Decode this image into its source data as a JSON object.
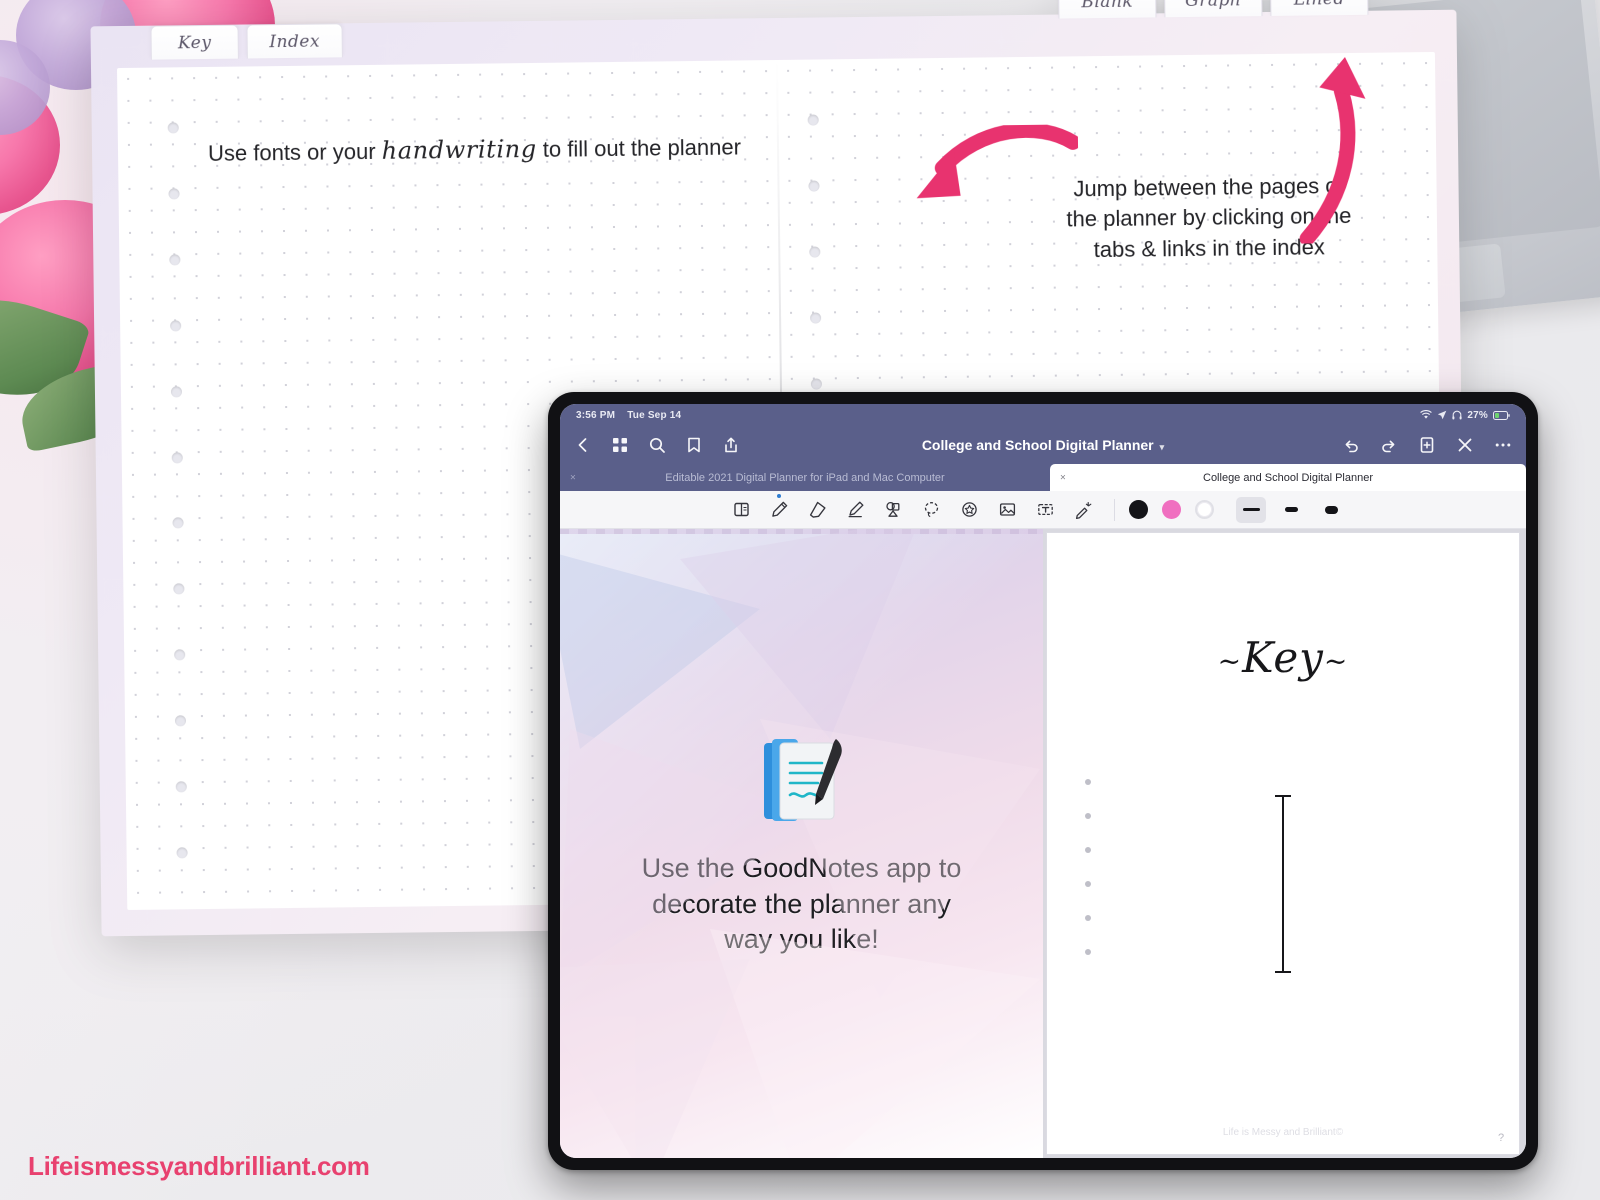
{
  "planner": {
    "tabs_left": [
      {
        "label": "Key"
      },
      {
        "label": "Index"
      }
    ],
    "tabs_top": [
      {
        "label": "Blank"
      },
      {
        "label": "Graph"
      },
      {
        "label": "Lined"
      }
    ],
    "headline": {
      "part1": "Use fonts or your ",
      "script": "handwriting",
      "part2": " to fill out the planner"
    },
    "annotation": "Jump between the pages of the planner by clicking on the tabs & links in the index"
  },
  "ipad": {
    "status_bar": {
      "time": "3:56 PM",
      "date": "Tue Sep 14",
      "battery": "27%",
      "icons": [
        "wifi-icon",
        "location-icon",
        "headphones-icon",
        "battery-icon"
      ]
    },
    "nav_bar": {
      "title": "College and School Digital Planner",
      "caret": "▾",
      "left_icons": [
        "back-chevron-icon",
        "thumbnail-grid-icon",
        "search-icon",
        "bookmark-icon",
        "share-icon"
      ],
      "right_icons": [
        "undo-icon",
        "redo-icon",
        "add-page-icon",
        "close-icon",
        "more-options-icon"
      ]
    },
    "document_tabs": [
      {
        "label": "Editable 2021 Digital Planner for iPad and Mac Computer",
        "close": "×",
        "active": false
      },
      {
        "label": "College and School Digital Planner",
        "close": "×",
        "active": true
      }
    ],
    "toolbar": {
      "tools": [
        {
          "name": "page-panel-icon",
          "selected": false
        },
        {
          "name": "pen-icon",
          "selected": true
        },
        {
          "name": "eraser-icon",
          "selected": false
        },
        {
          "name": "highlighter-icon",
          "selected": false
        },
        {
          "name": "shapes-icon",
          "selected": false
        },
        {
          "name": "lasso-icon",
          "selected": false
        },
        {
          "name": "sticker-icon",
          "selected": false
        },
        {
          "name": "image-icon",
          "selected": false
        },
        {
          "name": "text-box-icon",
          "selected": false
        },
        {
          "name": "laser-pointer-icon",
          "selected": false
        }
      ],
      "colors": [
        {
          "name": "black",
          "hex": "#141418",
          "selected": true
        },
        {
          "name": "pink",
          "hex": "#f06fc0",
          "selected": false
        },
        {
          "name": "white",
          "hex": "#ffffff",
          "selected": false
        }
      ],
      "stroke_widths": [
        {
          "name": "thin",
          "selected": true
        },
        {
          "name": "medium",
          "selected": false
        },
        {
          "name": "thick",
          "selected": false
        }
      ]
    },
    "page_left": {
      "icon": "goodnotes-app-icon",
      "text_lines": [
        "Use the GoodNotes app to",
        "decorate the planner any",
        "way you like!"
      ]
    },
    "page_right": {
      "title": "Key",
      "swash_left": "~",
      "swash_right": "~",
      "footer": "Life is Messy and Brilliant©",
      "help": "?"
    }
  },
  "watermark": "Lifeismessyandbrilliant.com",
  "colors": {
    "accent_pink": "#e8416f",
    "nav_purple": "#5a5f8a",
    "tool_pink": "#f06fc0"
  }
}
